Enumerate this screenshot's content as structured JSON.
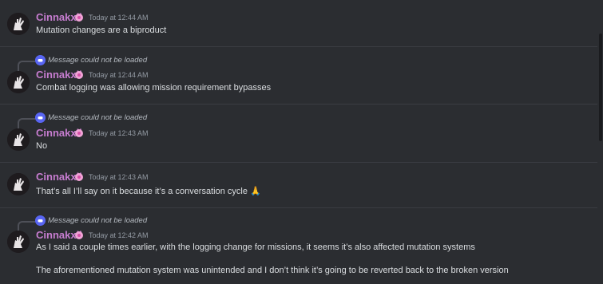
{
  "messages": [
    {
      "username": "Cinnakxll",
      "timestamp": "Today at 12:44 AM",
      "reply": "",
      "lines": [
        "Mutation changes are a biproduct"
      ]
    },
    {
      "username": "Cinnakxll",
      "timestamp": "Today at 12:44 AM",
      "reply": "Message could not be loaded",
      "lines": [
        "Combat logging was allowing mission requirement bypasses"
      ]
    },
    {
      "username": "Cinnakxll",
      "timestamp": "Today at 12:43 AM",
      "reply": "Message could not be loaded",
      "lines": [
        "No"
      ]
    },
    {
      "username": "Cinnakxll",
      "timestamp": "Today at 12:43 AM",
      "reply": "",
      "lines": [
        "That’s all I’ll say on it because it’s a conversation cycle"
      ],
      "emoji": "🙏"
    },
    {
      "username": "Cinnakxll",
      "timestamp": "Today at 12:42 AM",
      "reply": "Message could not be loaded",
      "lines": [
        "As I said a couple times earlier, with the logging change for missions, it seems it’s also affected mutation systems",
        "The aforementioned mutation system was unintended and I don’t think it’s going to be reverted back to the broken version"
      ]
    }
  ],
  "icons": {
    "avatar": "avatar-hand-icon",
    "badge": "pink-flower-badge-icon",
    "reply": "discord-icon"
  },
  "colors": {
    "background": "#2b2d31",
    "username": "#c77dd0",
    "text": "#dbdee1",
    "timestamp": "#949ba4",
    "reply_icon": "#5865f2"
  }
}
